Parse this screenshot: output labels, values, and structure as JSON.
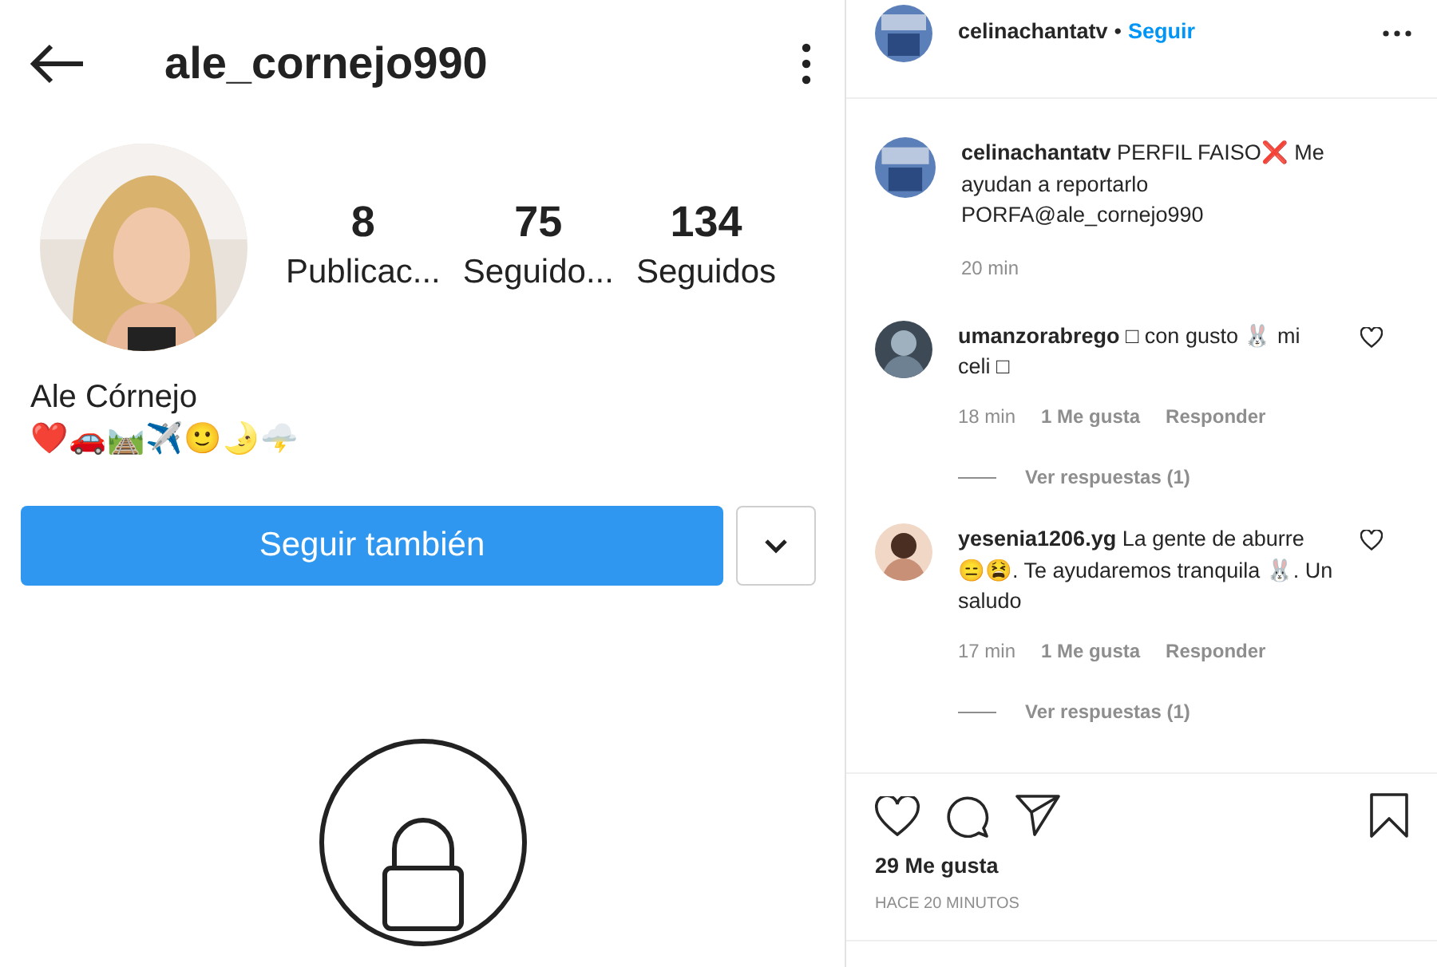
{
  "profile": {
    "username": "ale_cornejo990",
    "stats": [
      {
        "value": "8",
        "label": "Publicac..."
      },
      {
        "value": "75",
        "label": "Seguido..."
      },
      {
        "value": "134",
        "label": "Seguidos"
      }
    ],
    "name": "Ale Córnejo",
    "bio": "❤️🚗🛤️✈️🙂🌛🌩️",
    "follow_button": "Seguir también"
  },
  "post": {
    "author": "celinachantatv",
    "separator": "•",
    "follow_label": "Seguir",
    "caption": {
      "author": "celinachantatv",
      "text": "PERFIL FAISO❌ Me ayudan a reportarlo PORFA@ale_cornejo990",
      "time": "20 min"
    },
    "comments": [
      {
        "author": "umanzorabrego",
        "text": "□ con gusto 🐰 mi celi □",
        "time": "18 min",
        "likes": "1 Me gusta",
        "reply": "Responder",
        "view_replies": "Ver respuestas (1)",
        "liked": false
      },
      {
        "author": "yesenia1206.yg",
        "text": "La gente de aburre 😑😫. Te ayudaremos tranquila 🐰. Un saludo",
        "time": "17 min",
        "likes": "1 Me gusta",
        "reply": "Responder",
        "view_replies": "Ver respuestas (1)",
        "liked": false
      }
    ],
    "likes": "29 Me gusta",
    "timestamp": "HACE 20 MINUTOS"
  }
}
